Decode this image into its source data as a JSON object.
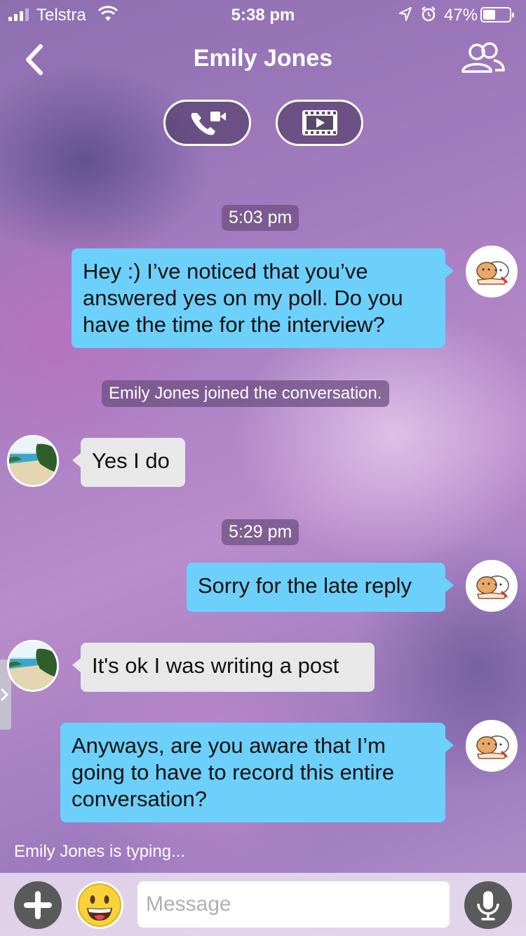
{
  "status_bar": {
    "carrier": "Telstra",
    "time": "5:38 pm",
    "battery": "47%",
    "battery_level": 0.47
  },
  "header": {
    "title": "Emily Jones",
    "back_icon": "chevron-left-icon",
    "members_icon": "people-icon",
    "voice_call_icon": "phone-video-icon",
    "video_icon": "film-play-icon"
  },
  "messages": [
    {
      "type": "timestamp",
      "text": "5:03 pm"
    },
    {
      "type": "outgoing",
      "text": "Hey :) I’ve noticed that you’ve answered yes on my poll. Do you have the time for the interview?"
    },
    {
      "type": "system",
      "text": "Emily Jones joined the conversation."
    },
    {
      "type": "incoming",
      "text": "Yes I do"
    },
    {
      "type": "timestamp",
      "text": "5:29 pm"
    },
    {
      "type": "outgoing",
      "text": "Sorry for the late reply"
    },
    {
      "type": "incoming",
      "text": "It's ok I was writing a post"
    },
    {
      "type": "outgoing",
      "text": "Anyways, are you aware that I’m going to have to record this entire conversation?"
    }
  ],
  "typing_indicator": "Emily Jones is typing...",
  "composer": {
    "placeholder": "Message",
    "plus_icon": "plus-icon",
    "emoji_icon": "grinning-face-icon",
    "mic_icon": "microphone-icon"
  },
  "colors": {
    "outgoing_bubble": "#6cd0fa",
    "incoming_bubble": "#e8e8e8"
  }
}
